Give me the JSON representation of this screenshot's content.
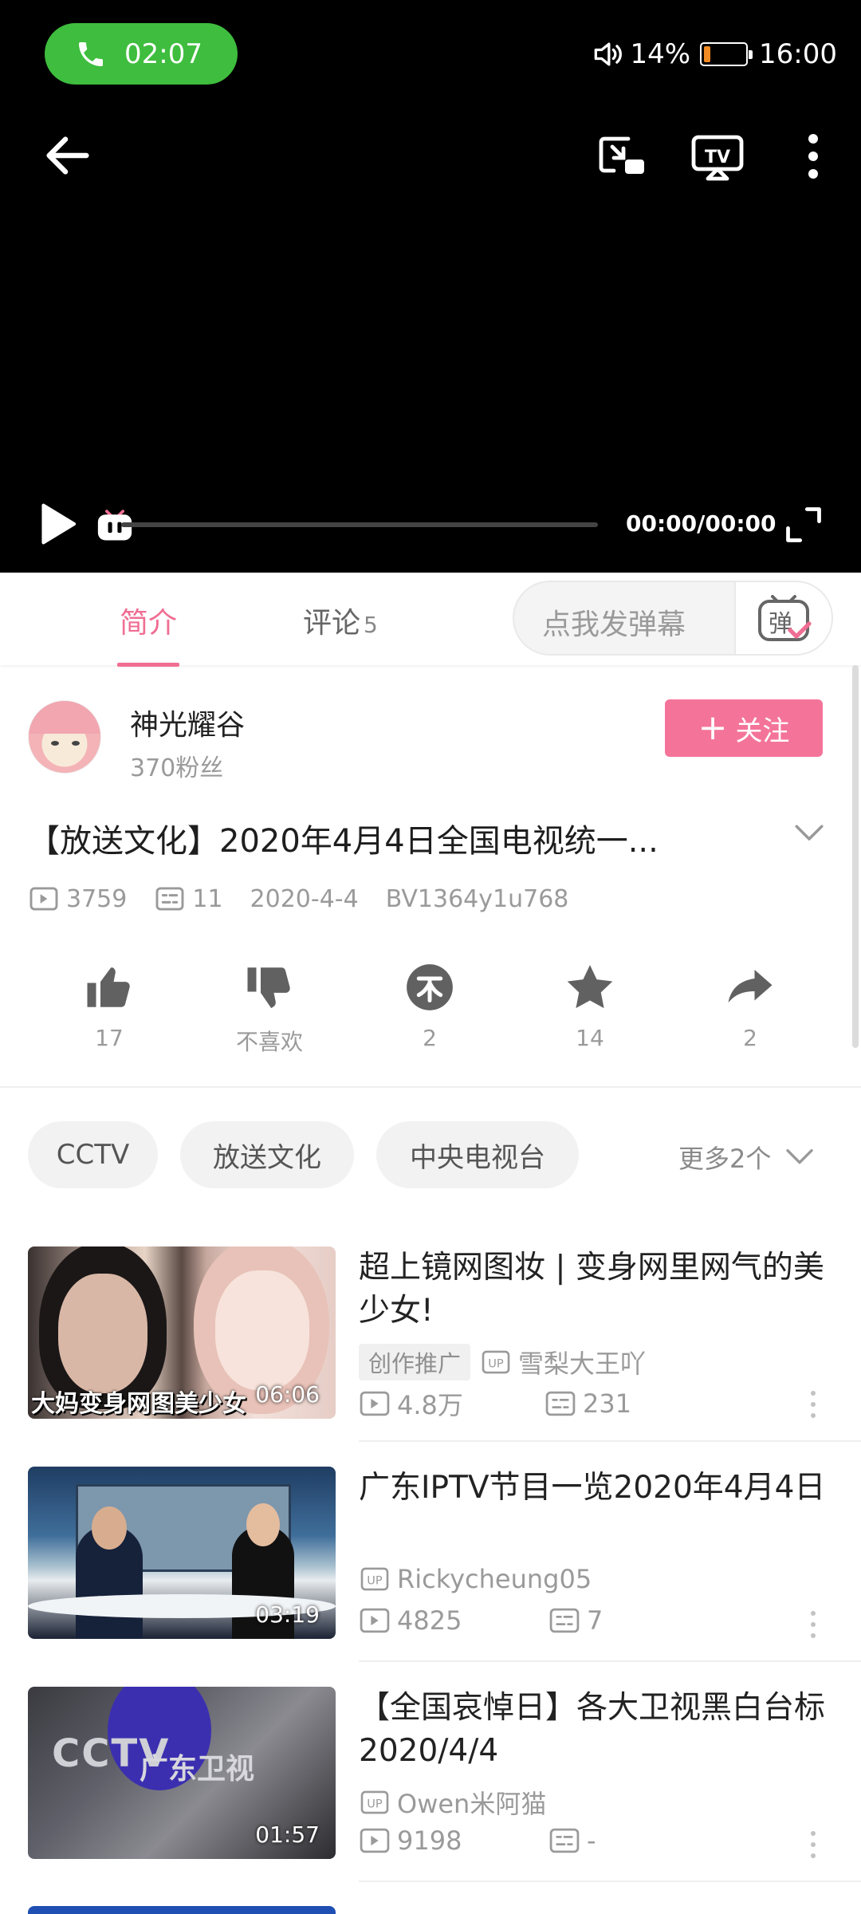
{
  "status_bar": {
    "call_time": "02:07",
    "battery": "14%",
    "clock": "16:00",
    "battery_level": 0.14
  },
  "player": {
    "time": "00:00/00:00",
    "progress": 0
  },
  "tabs": {
    "intro": "简介",
    "comments": "评论",
    "comments_count": "5"
  },
  "danmu": {
    "placeholder": "点我发弹幕"
  },
  "uploader": {
    "name": "神光耀谷",
    "fans": "370粉丝",
    "follow": "关注"
  },
  "video": {
    "title": "【放送文化】2020年4月4日全国电视统一...",
    "views": "3759",
    "danmaku": "11",
    "date": "2020-4-4",
    "bvid": "BV1364y1u768"
  },
  "actions": {
    "like": "17",
    "dislike": "不喜欢",
    "coin": "2",
    "favorite": "14",
    "share": "2"
  },
  "tags": {
    "items": [
      "CCTV",
      "放送文化",
      "中央电视台"
    ],
    "more": "更多2个"
  },
  "recommendations": [
    {
      "title": "超上镜网图妆 | 变身网里网气的美少女!",
      "badge": "创作推广",
      "up": "雪梨大王吖",
      "views": "4.8万",
      "danmaku": "231",
      "duration": "06:06",
      "overlay": "大妈变身网图美少女"
    },
    {
      "title": "广东IPTV节目一览2020年4月4日",
      "up": "Rickycheung05",
      "views": "4825",
      "danmaku": "7",
      "duration": "03:19"
    },
    {
      "title": "【全国哀悼日】各大卫视黑白台标 2020/4/4",
      "up": "Owen米阿猫",
      "views": "9198",
      "danmaku": "-",
      "duration": "01:57",
      "overlay": "广东卫视"
    }
  ],
  "colors": {
    "accent": "#f06e93",
    "follow_bg": "#f47499",
    "call_green": "#3ebd3e"
  }
}
